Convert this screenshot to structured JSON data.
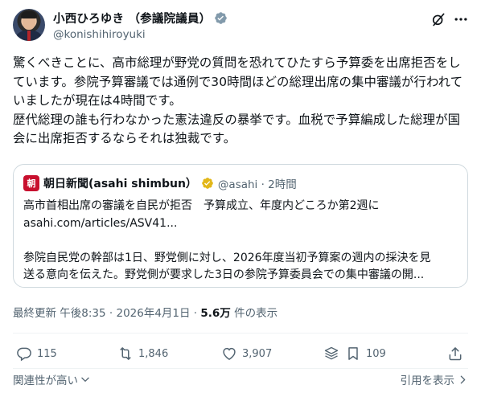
{
  "author": {
    "display_name": "小西ひろゆき （参議院議員）",
    "handle": "@konishihiroyuki"
  },
  "post": {
    "body": "驚くべきことに、高市総理が野党の質問を恐れてひたすら予算委を出席拒否をしています。参院予算審議では通例で30時間ほどの総理出席の集中審議が行われていましたが現在は4時間です。\n歴代総理の誰も行わなかった憲法違反の暴挙です。血税で予算編成した総理が国会に出席拒否するならそれは独裁です。"
  },
  "quoted": {
    "logo_text": "朝",
    "source_name": "朝日新聞(asahi shimbun）",
    "source_handle": "@asahi · 2時間",
    "headline": "高市首相出席の審議を自民が拒否　予算成立、年度内どころか第2週に",
    "link": "asahi.com/articles/ASV41...",
    "excerpt_line1": "参院自民党の幹部は1日、野党側に対し、2026年度当初予算案の週内の採決を見",
    "excerpt_line2": "送る意向を伝えた。野党側が要求した3日の参院予算委員会での集中審議の開..."
  },
  "meta": {
    "timestamp": "最終更新 午後8:35 · 2026年4月1日 · ",
    "views": "5.6万",
    "views_suffix": " 件の表示"
  },
  "actions": {
    "replies": "115",
    "reposts": "1,846",
    "likes": "3,907",
    "bookmarks": "109"
  },
  "footer": {
    "relevance": "関連性が高い",
    "quotes": "引用を表示"
  },
  "colors": {
    "text_primary": "#0f1419",
    "text_secondary": "#536471",
    "verified_blue": "#1d9bf0",
    "gov_gold": "#e2b719",
    "asahi_red": "#c8102e",
    "border": "#cfd9de"
  },
  "icons": {
    "verified": "verified-badge-icon",
    "grok": "grok-icon",
    "more": "more-icon",
    "reply": "reply-icon",
    "repost": "repost-icon",
    "like": "like-icon",
    "stack": "stack-icon",
    "bookmark": "bookmark-icon",
    "share": "share-icon",
    "chevron": "chevron-down-icon"
  }
}
